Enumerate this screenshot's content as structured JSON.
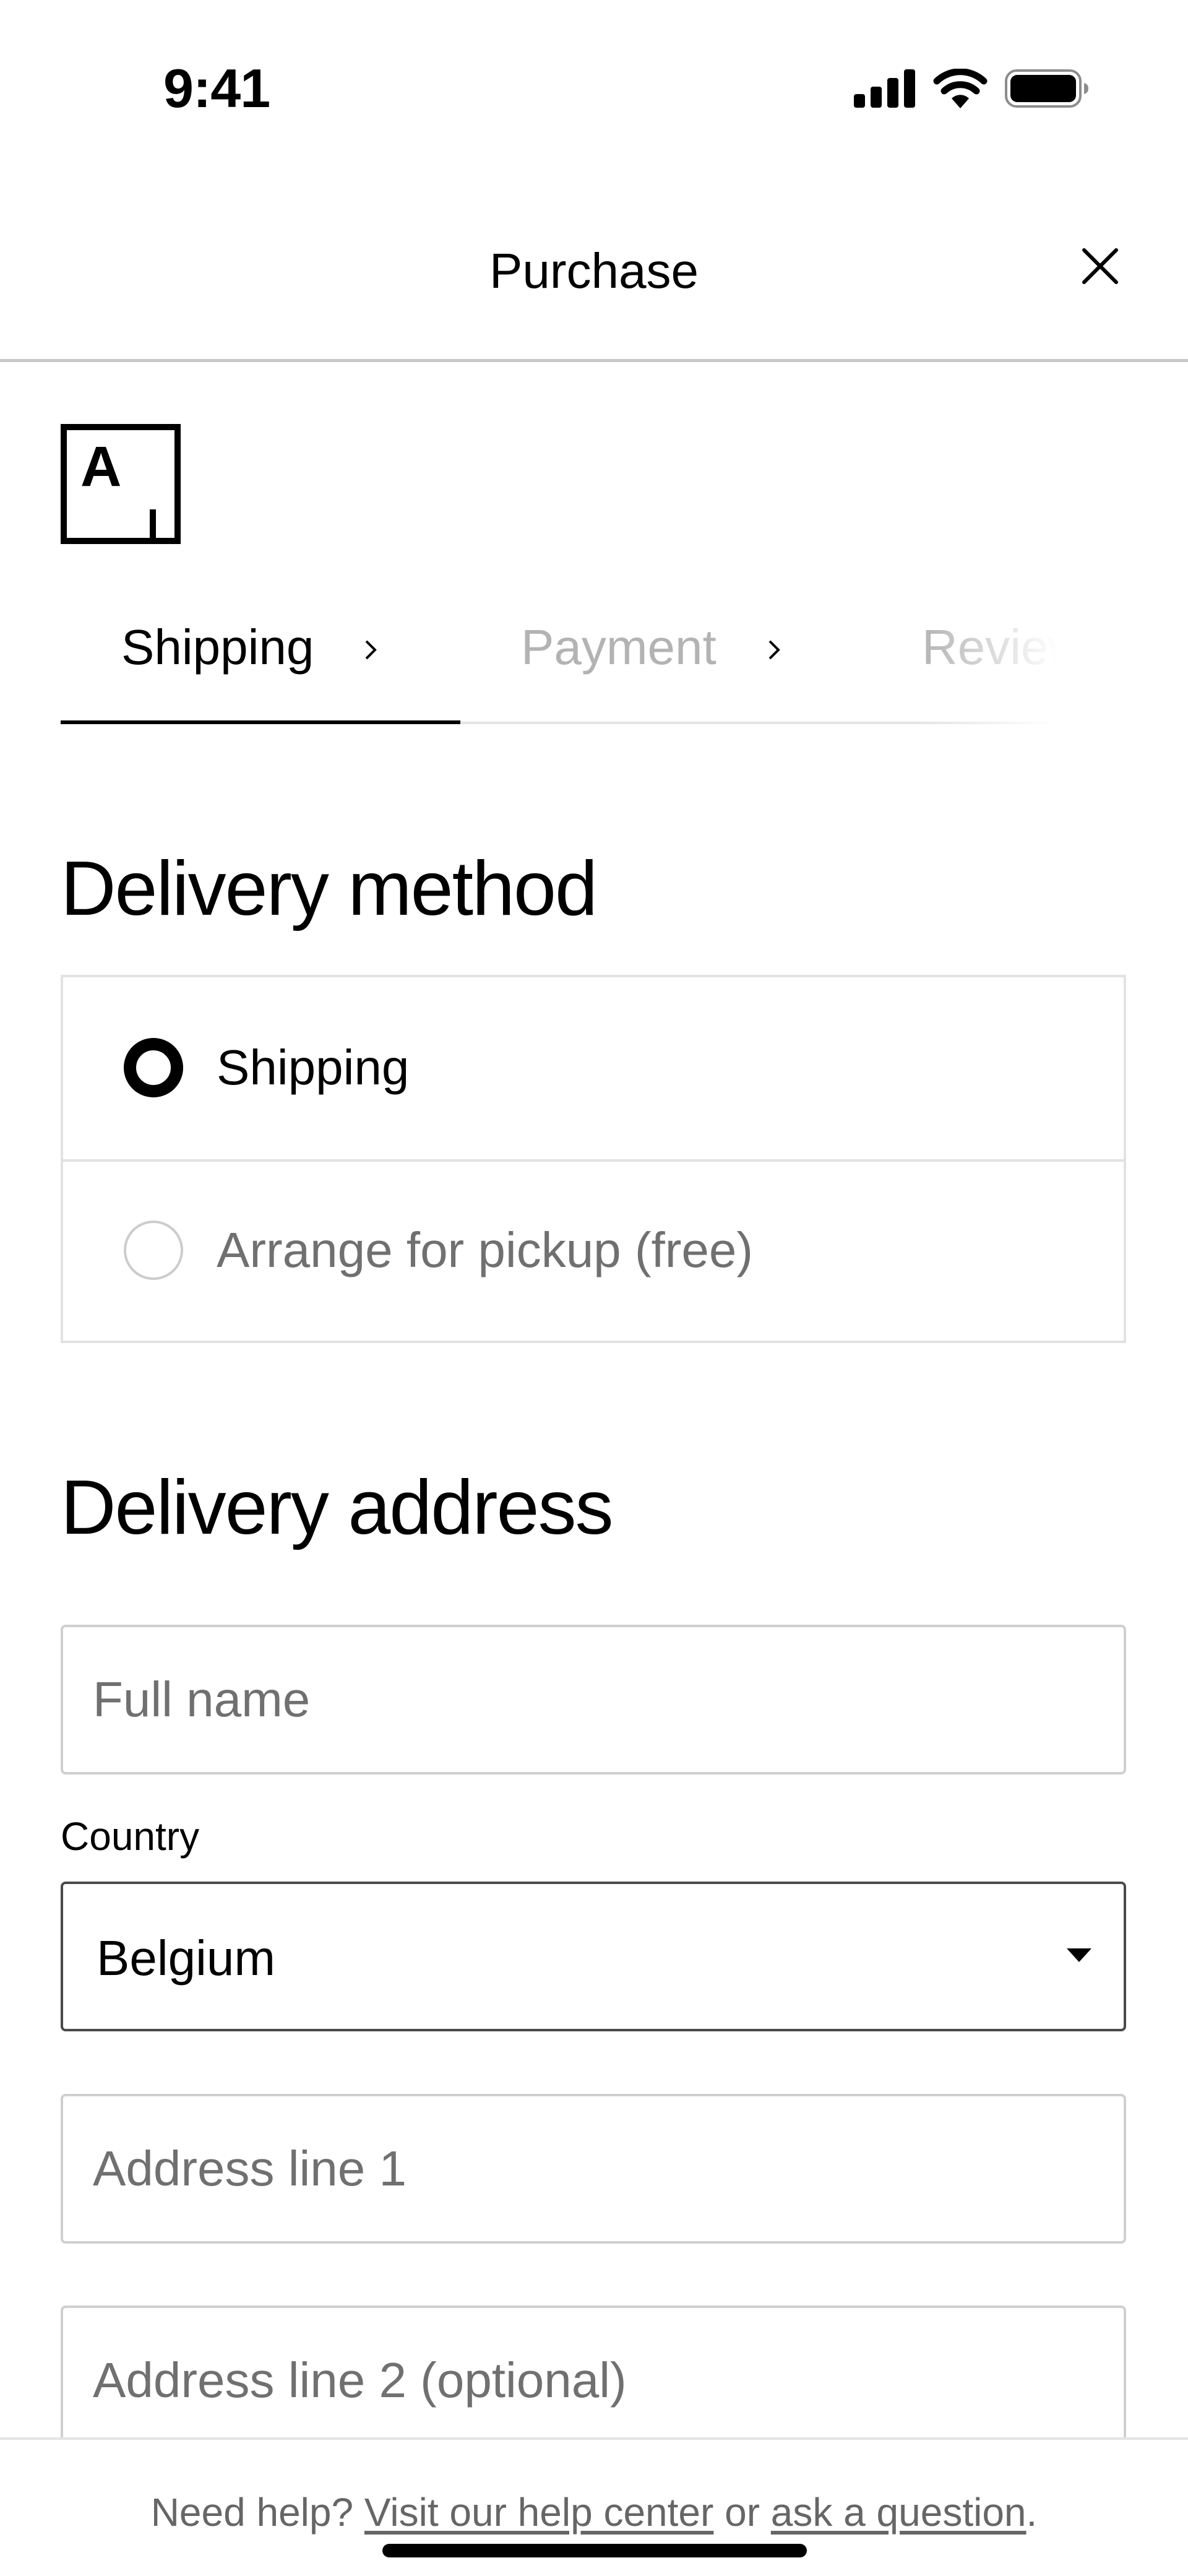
{
  "status_bar": {
    "time": "9:41",
    "icons": [
      "cellular-signal-icon",
      "wifi-icon",
      "battery-icon"
    ]
  },
  "header": {
    "title": "Purchase",
    "close_icon": "close-icon"
  },
  "logo": {
    "letter": "A"
  },
  "steps": [
    {
      "label": "Shipping",
      "active": true
    },
    {
      "label": "Payment",
      "active": false
    },
    {
      "label": "Review",
      "active": false
    }
  ],
  "delivery_method": {
    "title": "Delivery method",
    "options": [
      {
        "label": "Shipping",
        "selected": true
      },
      {
        "label": "Arrange for pickup (free)",
        "selected": false
      }
    ]
  },
  "delivery_address": {
    "title": "Delivery address",
    "full_name": {
      "placeholder": "Full name",
      "value": ""
    },
    "country": {
      "label": "Country",
      "value": "Belgium"
    },
    "address_line_1": {
      "placeholder": "Address line 1",
      "value": ""
    },
    "address_line_2": {
      "placeholder": "Address line 2 (optional)",
      "value": ""
    }
  },
  "footer": {
    "prefix": "Need help?",
    "help_center_link": "Visit our help center",
    "middle": "or",
    "ask_link": "ask a question",
    "suffix": "."
  },
  "colors": {
    "text_primary": "#000000",
    "text_muted": "#707070",
    "border_light": "#e2e2e2",
    "inactive_step": "#b3b3b3"
  }
}
